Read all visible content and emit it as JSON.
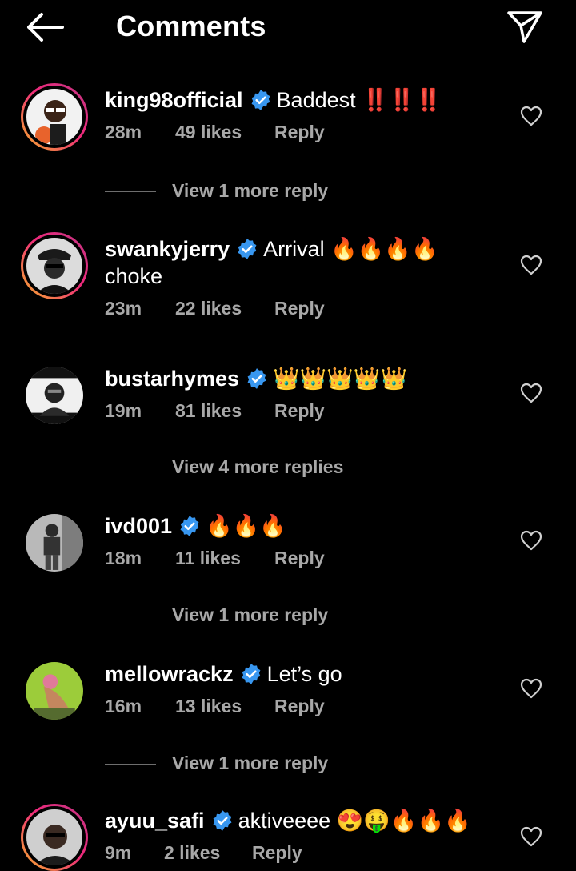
{
  "header": {
    "title": "Comments",
    "back_icon": "arrow-left-icon",
    "send_icon": "paper-plane-icon"
  },
  "comments": [
    {
      "username": "king98official",
      "verified": true,
      "text": "Baddest ‼️‼️‼️",
      "time": "28m",
      "likes": "49 likes",
      "reply": "Reply",
      "view_more": "View 1 more reply"
    },
    {
      "username": "swankyjerry",
      "verified": true,
      "text": "Arrival 🔥🔥🔥🔥 choke",
      "time": "23m",
      "likes": "22 likes",
      "reply": "Reply",
      "view_more": ""
    },
    {
      "username": "bustarhymes",
      "verified": true,
      "text": "👑👑👑👑👑",
      "time": "19m",
      "likes": "81 likes",
      "reply": "Reply",
      "view_more": "View 4 more replies"
    },
    {
      "username": "ivd001",
      "verified": true,
      "text": "🔥🔥🔥",
      "time": "18m",
      "likes": "11 likes",
      "reply": "Reply",
      "view_more": "View 1 more reply"
    },
    {
      "username": "mellowrackz",
      "verified": true,
      "text": "Let’s go",
      "time": "16m",
      "likes": "13 likes",
      "reply": "Reply",
      "view_more": "View 1 more reply"
    },
    {
      "username": "ayuu_safi",
      "verified": true,
      "text": "aktiveeee 😍🤑🔥🔥🔥",
      "time": "9m",
      "likes": "2 likes",
      "reply": "Reply",
      "view_more": ""
    }
  ],
  "colors": {
    "background": "#000000",
    "meta": "#a8a8a8",
    "verified": "#3897f0",
    "story_ring_start": "#f7b12a",
    "story_ring_end": "#c13584"
  }
}
